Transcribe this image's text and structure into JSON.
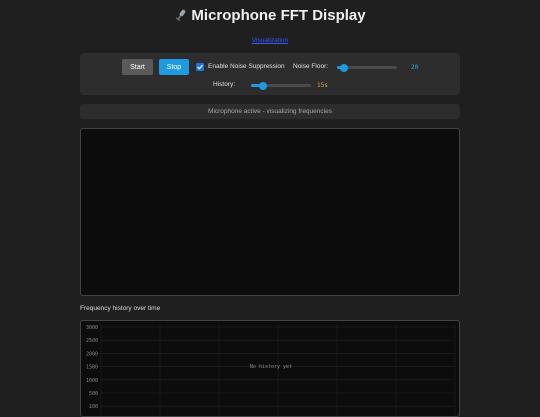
{
  "header": {
    "title": "Microphone FFT Display",
    "link_text": "Visualization"
  },
  "controls": {
    "start_label": "Start",
    "stop_label": "Stop",
    "noise_suppression_label": "Enable Noise Suppression",
    "noise_suppression_checked": true,
    "noise_floor_label": "Noise Floor:",
    "noise_floor_value": "20",
    "noise_floor_level": 0.12,
    "history_label": "History:",
    "history_value": "15s",
    "history_level": 0.2
  },
  "status": {
    "text": "Microphone active - visualizing frequencies"
  },
  "history_section": {
    "title": "Frequency history over time",
    "empty_text": "No history yet",
    "y_ticks": [
      "3000",
      "2500",
      "2000",
      "1500",
      "1000",
      "500",
      "100"
    ]
  },
  "colors": {
    "accent": "#1e9be0",
    "history_value": "#e0a030",
    "background": "#1f1f1f",
    "panel": "#2d2d2d"
  }
}
